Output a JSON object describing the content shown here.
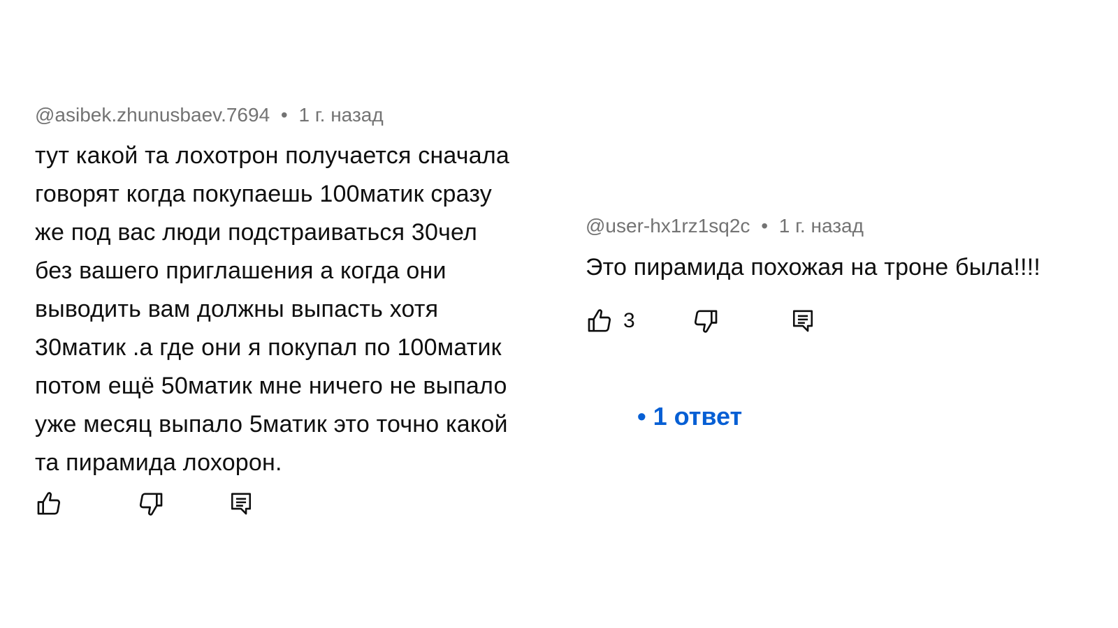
{
  "comments": [
    {
      "author": "@asibek.zhunusbaev.7694",
      "separator": "•",
      "time": "1 г. назад",
      "lines": [
        "тут какой та лохотрон получается сначала",
        "говорят когда покупаешь 100матик сразу",
        "же под вас люди подстраиваться 30чел",
        "без вашего приглашения а когда они",
        "выводить вам должны выпасть хотя",
        "30матик .а где они я покупал по 100матик",
        "потом ещё 50матик мне ничего не выпало",
        "уже месяц выпало 5матик это точно какой",
        "та пирамида лохорон."
      ],
      "icons": {
        "like": "thumb-up-icon",
        "dislike": "thumb-down-icon",
        "reply": "comment-reply-icon"
      }
    },
    {
      "author": "@user-hx1rz1sq2c",
      "separator": "•",
      "time": "1 г. назад",
      "text": "Это пирамида похожая на троне была!!!!",
      "like_count": "3",
      "icons": {
        "like": "thumb-up-icon",
        "dislike": "thumb-down-icon",
        "reply": "comment-reply-icon"
      },
      "replies": {
        "bullet": "•",
        "label": "1 ответ",
        "color": "#065fd4"
      }
    }
  ],
  "colors": {
    "meta": "#737373",
    "text": "#0f0f0f",
    "link": "#065fd4"
  }
}
